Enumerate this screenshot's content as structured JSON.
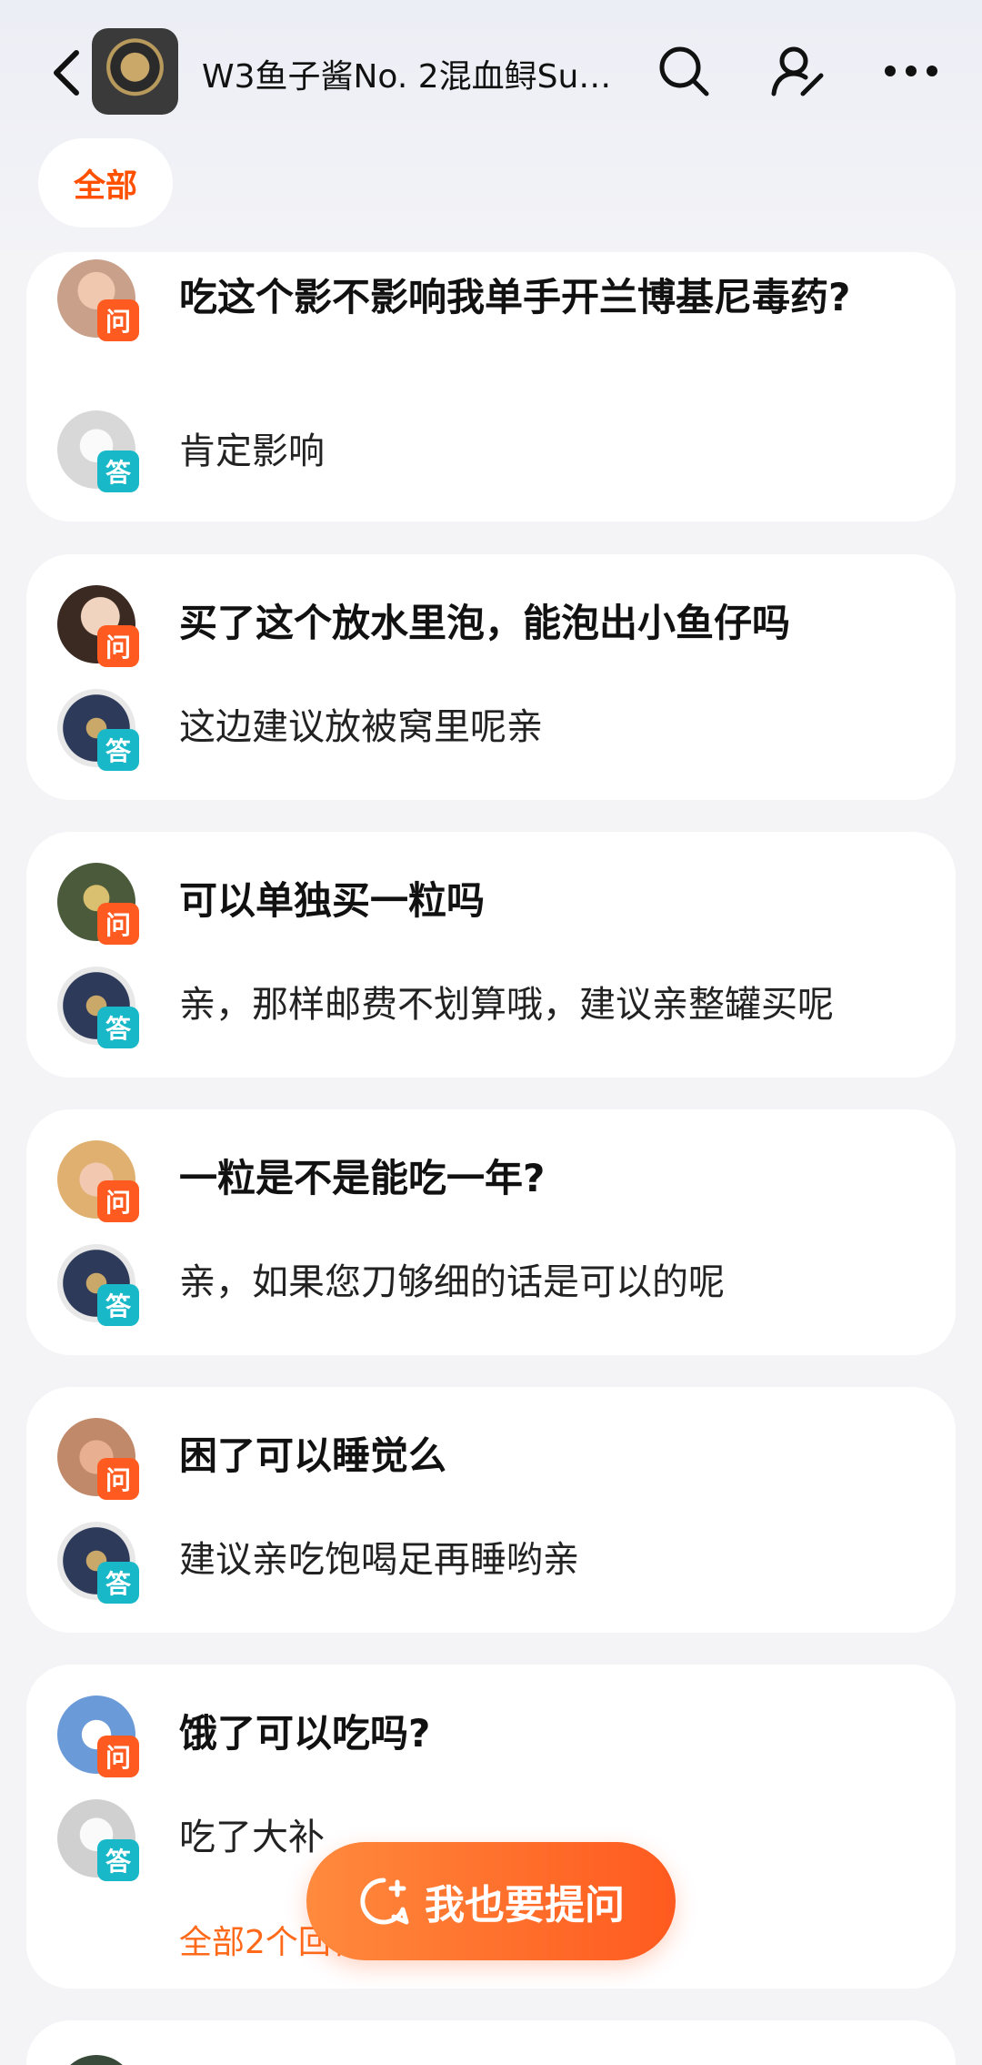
{
  "header": {
    "title": "W3鱼子酱No. 2混血鲟Sup...",
    "icons": [
      "back-icon",
      "search-icon",
      "user-edit-icon",
      "more-icon"
    ]
  },
  "filter": {
    "all_label": "全部"
  },
  "badges": {
    "question": "问",
    "answer": "答"
  },
  "items": [
    {
      "question": "吃这个影不影响我单手开兰博基尼毒药?",
      "answer": "肯定影响",
      "q_avatar_color": "#c9a08a",
      "a_avatar_color": "#d8d8d8"
    },
    {
      "question": "买了这个放水里泡，能泡出小鱼仔吗",
      "answer": "这边建议放被窝里呢亲",
      "q_avatar_color": "#8a6a5a",
      "a_avatar_color": "#2d3a5a"
    },
    {
      "question": "可以单独买一粒吗",
      "answer": "亲，那样邮费不划算哦，建议亲整罐买呢",
      "q_avatar_color": "#4a5a3a",
      "a_avatar_color": "#2d3a5a"
    },
    {
      "question": "一粒是不是能吃一年?",
      "answer": "亲，如果您刀够细的话是可以的呢",
      "q_avatar_color": "#e0b070",
      "a_avatar_color": "#2d3a5a"
    },
    {
      "question": "困了可以睡觉么",
      "answer": "建议亲吃饱喝足再睡哟亲",
      "q_avatar_color": "#c08a6a",
      "a_avatar_color": "#2d3a5a"
    },
    {
      "question": "饿了可以吃吗?",
      "answer": "吃了大补",
      "more": "全部2个回答",
      "q_avatar_color": "#6a9ad8",
      "a_avatar_color": "#d0d0d0"
    }
  ],
  "ask_button": {
    "label": "我也要提问"
  },
  "colors": {
    "accent": "#ff5000",
    "question_badge": "#ff5a1f",
    "answer_badge": "#19b8c8"
  }
}
